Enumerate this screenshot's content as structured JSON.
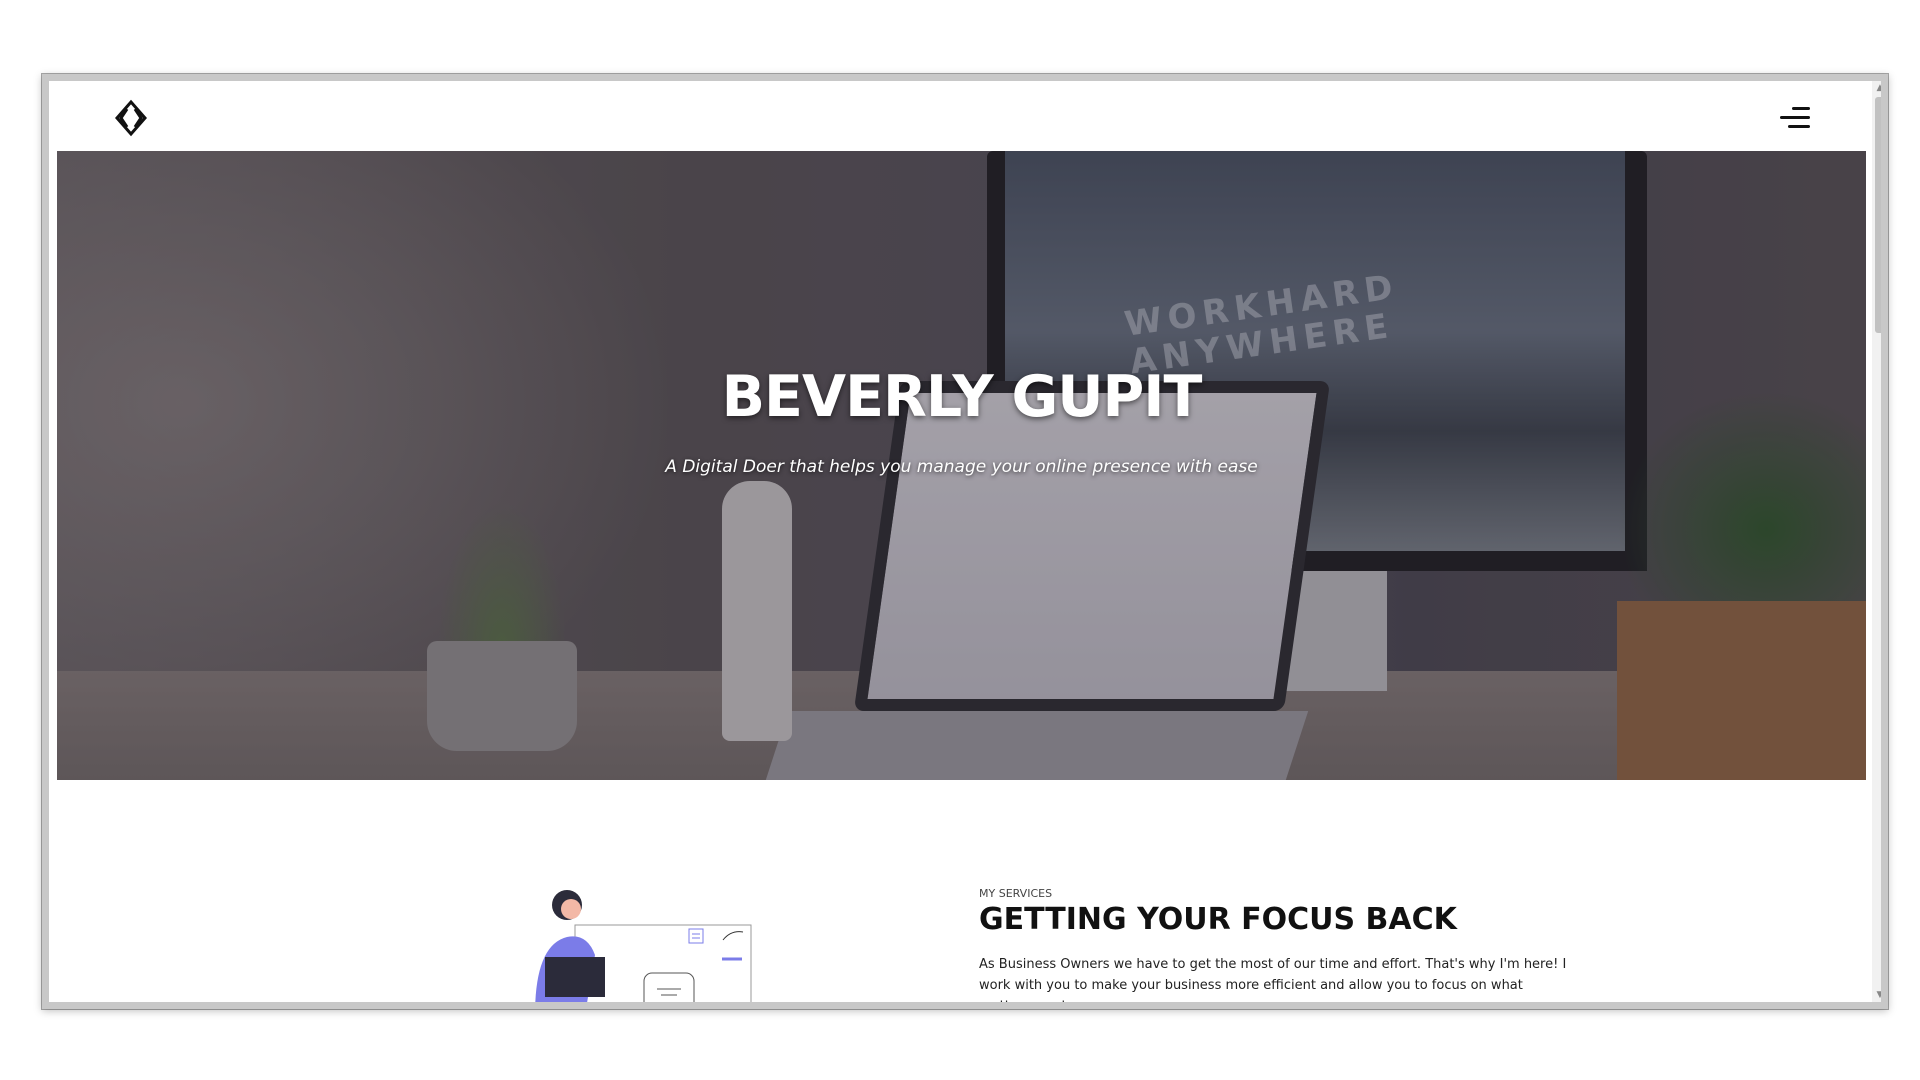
{
  "header": {
    "logo_icon": "diamond-chevron-logo",
    "menu_icon": "hamburger-menu-icon"
  },
  "hero": {
    "title": "BEVERLY GUPIT",
    "subtitle": "A Digital Doer that helps you manage your online presence with ease",
    "imac_text": "WORKHARD ANYWHERE"
  },
  "services": {
    "eyebrow": "MY SERVICES",
    "title": "GETTING YOUR FOCUS BACK",
    "body": "As Business Owners we have to get the most of our time and effort. That's why I'm here! I work with you to make your business more efficient and allow you to focus on what matters most."
  },
  "scrollbar": {
    "up_icon": "scroll-up-arrow",
    "down_icon": "scroll-down-arrow"
  }
}
